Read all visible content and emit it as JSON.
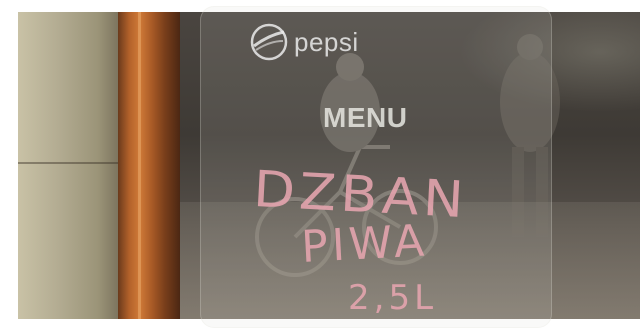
{
  "sign": {
    "logo_text": "pepsi",
    "menu_title": "MENU",
    "chalk_lines": [
      "DZBAN",
      "PIWA",
      "2,5L"
    ]
  },
  "colors": {
    "chalk": "#e6a5af",
    "frame_wood": "#b2612a",
    "wall": "#c9c2a6"
  },
  "icons": [
    "pepsi-globe-icon"
  ]
}
